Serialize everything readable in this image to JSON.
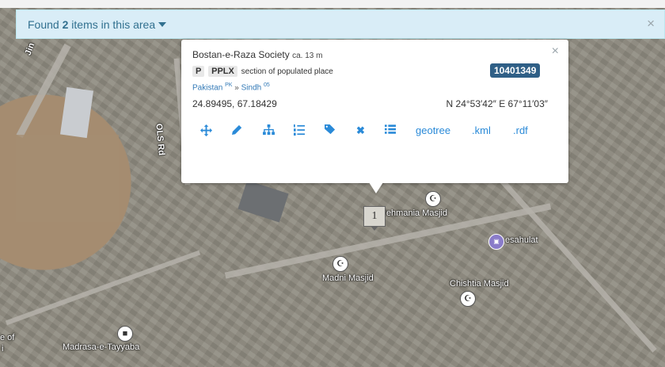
{
  "found_bar": {
    "prefix": "Found",
    "count": "2",
    "suffix": "items in this area",
    "close": "×"
  },
  "popup": {
    "name": "Bostan-e-Raza Society",
    "elevation": "ca. 13 m",
    "feature_class": "P",
    "feature_code": "PPLX",
    "feature_desc": "section of populated place",
    "geonameid": "10401349",
    "country": "Pakistan",
    "country_code": "PK",
    "admin": "Sindh",
    "admin_code": "05",
    "latlng": "24.89495, 67.18429",
    "dms": "N 24°53′42″ E 67°11′03″",
    "close": "×",
    "actions": {
      "move_icon": "arrows-icon",
      "edit_icon": "pencil-icon",
      "hierarchy_icon": "sitemap-icon",
      "list_icon": "list-ol-icon",
      "tags_icon": "tags-icon",
      "delete_icon": "times-icon",
      "table_icon": "table-list-icon",
      "geotree": "geotree",
      "kml": ".kml",
      "rdf": ".rdf"
    }
  },
  "map": {
    "marker_label": "1",
    "labels": {
      "road_jinnah": "Jin",
      "road_ols": "OLS Rd",
      "rehmania": "Rehmania Masjid",
      "esahulat": "esahulat",
      "madni": "Madni Masjid",
      "chishtia": "Chishtia Masjid",
      "madrasa": "Madrasa-e-Tayyaba",
      "edge_left": "e of",
      "edge_left2": "i"
    }
  }
}
